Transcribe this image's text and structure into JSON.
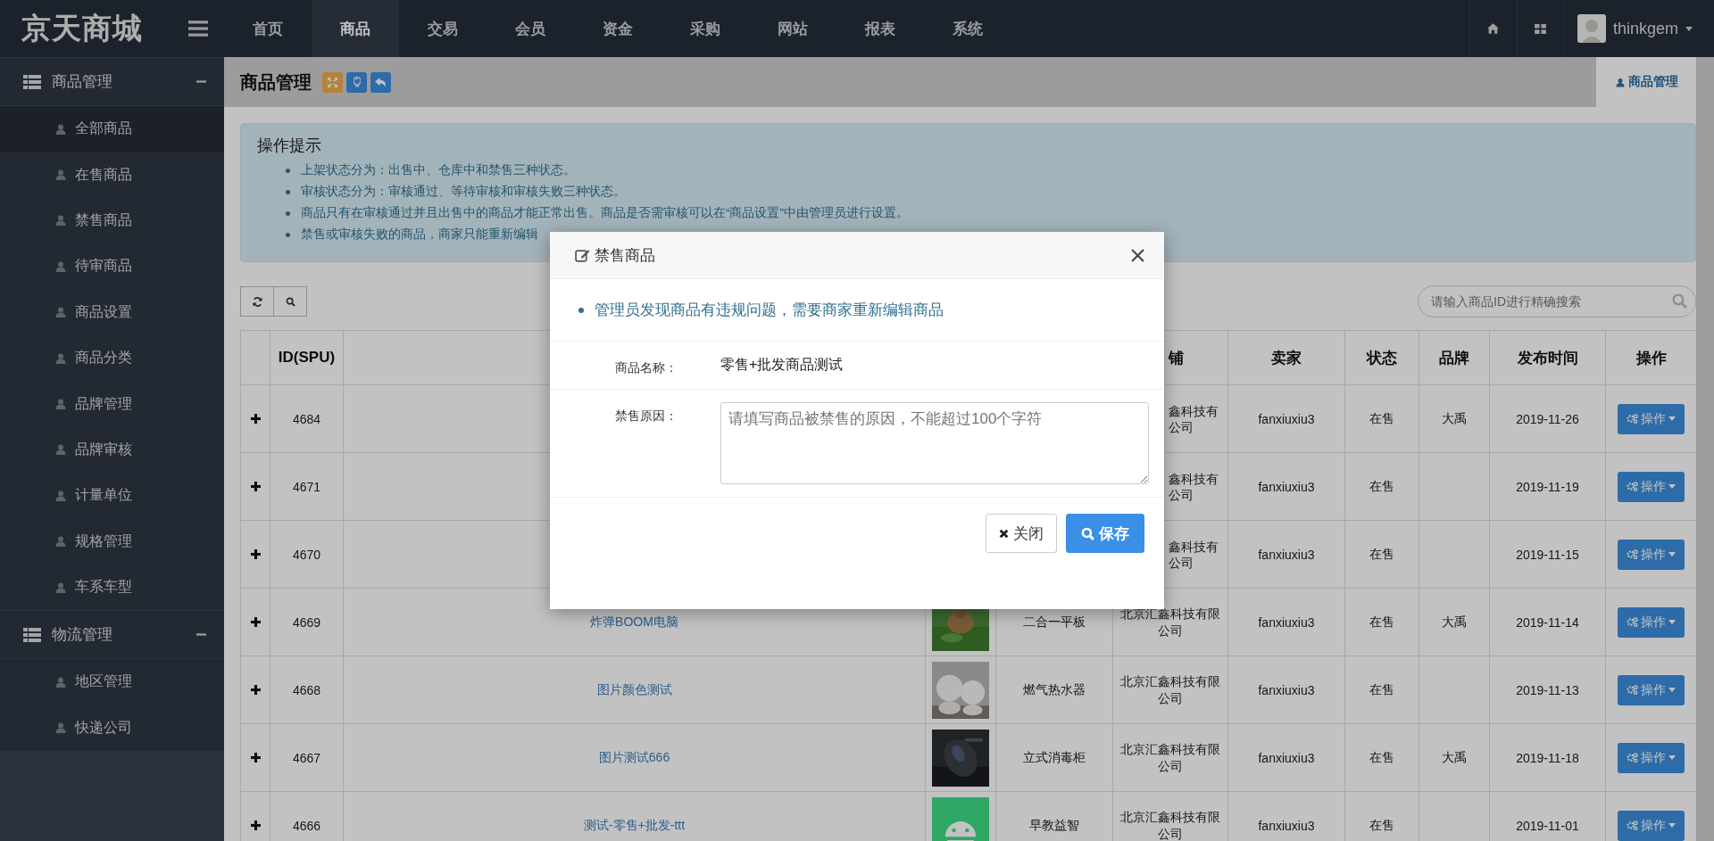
{
  "brand": {
    "name": "京天商城"
  },
  "nav": [
    {
      "label": "首页",
      "selected": false
    },
    {
      "label": "商品",
      "selected": true
    },
    {
      "label": "交易",
      "selected": false
    },
    {
      "label": "会员",
      "selected": false
    },
    {
      "label": "资金",
      "selected": false
    },
    {
      "label": "采购",
      "selected": false
    },
    {
      "label": "网站",
      "selected": false
    },
    {
      "label": "报表",
      "selected": false
    },
    {
      "label": "系统",
      "selected": false
    }
  ],
  "user": {
    "name": "thinkgem"
  },
  "sidebar": [
    {
      "title": "商品管理",
      "expanded": true,
      "items": [
        {
          "label": "全部商品",
          "selected": true
        },
        {
          "label": "在售商品",
          "selected": false
        },
        {
          "label": "禁售商品",
          "selected": false
        },
        {
          "label": "待审商品",
          "selected": false
        },
        {
          "label": "商品设置",
          "selected": false
        },
        {
          "label": "商品分类",
          "selected": false
        },
        {
          "label": "品牌管理",
          "selected": false
        },
        {
          "label": "品牌审核",
          "selected": false
        },
        {
          "label": "计量单位",
          "selected": false
        },
        {
          "label": "规格管理",
          "selected": false
        },
        {
          "label": "车系车型",
          "selected": false
        }
      ]
    },
    {
      "title": "物流管理",
      "expanded": true,
      "items": [
        {
          "label": "地区管理",
          "selected": false
        },
        {
          "label": "快递公司",
          "selected": false
        }
      ]
    }
  ],
  "page": {
    "title": "商品管理",
    "tab": "商品管理"
  },
  "tips": {
    "title": "操作提示",
    "items": [
      "上架状态分为：出售中、仓库中和禁售三种状态。",
      "审核状态分为：审核通过、等待审核和审核失败三种状态。",
      "商品只有在审核通过并且出售中的商品才能正常出售。商品是否需审核可以在“商品设置”中由管理员进行设置。",
      "禁售或审核失败的商品，商家只能重新编辑"
    ]
  },
  "search": {
    "placeholder": "请输入商品ID进行精确搜索"
  },
  "table": {
    "columns": [
      "ID(SPU)",
      "铺",
      "卖家",
      "状态",
      "品牌",
      "发布时间",
      "操作"
    ],
    "rows": [
      {
        "id": "4684",
        "store": "鑫科技有公司",
        "seller": "fanxiuxiu3",
        "status": "在售",
        "brand": "大禹",
        "date": "2019-11-26",
        "action": "操作"
      },
      {
        "id": "4671",
        "store": "鑫科技有公司",
        "seller": "fanxiuxiu3",
        "status": "在售",
        "date": "2019-11-19",
        "action": "操作"
      },
      {
        "id": "4670",
        "store": "鑫科技有公司",
        "seller": "fanxiuxiu3",
        "status": "在售",
        "date": "2019-11-15",
        "action": "操作"
      },
      {
        "id": "4669",
        "name": "炸弹BOOM电脑",
        "category": "二合一平板",
        "store": "北京汇鑫科技有限公司",
        "seller": "fanxiuxiu3",
        "status": "在售",
        "brand": "大禹",
        "date": "2019-11-14",
        "action": "操作"
      },
      {
        "id": "4668",
        "name": "图片颜色测试",
        "category": "燃气热水器",
        "store": "北京汇鑫科技有限公司",
        "seller": "fanxiuxiu3",
        "status": "在售",
        "date": "2019-11-13",
        "action": "操作"
      },
      {
        "id": "4667",
        "name": "图片测试666",
        "category": "立式消毒柜",
        "store": "北京汇鑫科技有限公司",
        "seller": "fanxiuxiu3",
        "status": "在售",
        "brand": "大禹",
        "date": "2019-11-18",
        "action": "操作"
      },
      {
        "id": "4666",
        "name": "测试-零售+批发-ttt",
        "category": "早教益智",
        "store": "北京汇鑫科技有限公司",
        "seller": "fanxiuxiu3",
        "status": "在售",
        "date": "2019-11-01",
        "action": "操作"
      }
    ]
  },
  "modal": {
    "title": "禁售商品",
    "notice": "管理员发现商品有违规问题，需要商家重新编辑商品",
    "fields": [
      {
        "kind": "text",
        "label": "商品名称：",
        "value": "零售+批发商品测试"
      },
      {
        "kind": "textarea",
        "label": "禁售原因：",
        "placeholder": "请填写商品被禁售的原因，不能超过100个字符"
      }
    ],
    "buttons": [
      {
        "kind": "close",
        "label": "关闭"
      },
      {
        "kind": "save",
        "label": "保存"
      }
    ]
  }
}
